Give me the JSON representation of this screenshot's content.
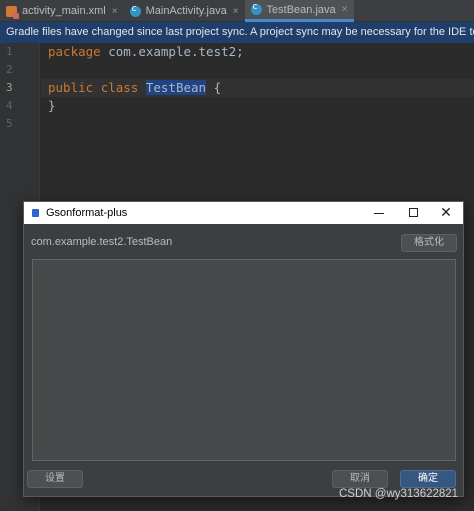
{
  "tabs": [
    {
      "label": "activity_main.xml",
      "icon": "xml-file-icon",
      "close": "×"
    },
    {
      "label": "MainActivity.java",
      "icon": "java-class-icon",
      "close": "×"
    },
    {
      "label": "TestBean.java",
      "icon": "java-class-icon",
      "close": "×",
      "active": true
    }
  ],
  "notification": "Gradle files have changed since last project sync. A project sync may be necessary for the IDE to work pr",
  "editor": {
    "line_numbers": [
      "1",
      "2",
      "3",
      "4",
      "5"
    ],
    "current_line": 3,
    "code": {
      "l1_kw": "package",
      "l1_rest": " com.example.test2;",
      "l3_kw1": "public",
      "l3_kw2": "class",
      "l3_class": "TestBean",
      "l3_brace": " {",
      "l4": "}"
    }
  },
  "dialog": {
    "title": "Gsonformat-plus",
    "class_path": "com.example.test2.TestBean",
    "format_button": "格式化",
    "json_input_value": "",
    "settings_button": "设置",
    "cancel_button": "取消",
    "ok_button": "确定",
    "close_glyph": "✕"
  },
  "watermark": "CSDN @wy313622821",
  "colors": {
    "accent": "#4a88c7",
    "keyword": "#cc7832",
    "selection": "#214283",
    "notification_bg": "#1f3e6b",
    "primary_button": "#365880"
  }
}
